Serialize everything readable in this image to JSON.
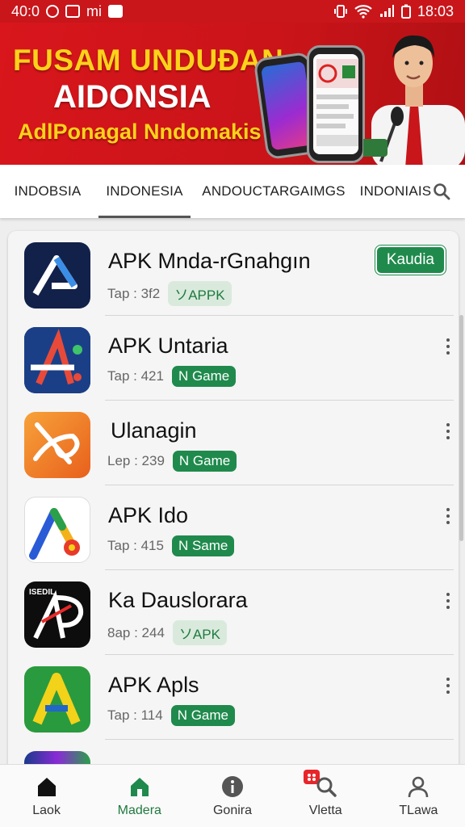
{
  "status": {
    "time_left": "40:0",
    "carrier": "mi",
    "time_right": "18:03"
  },
  "banner": {
    "title1": "FUSAM UNDUĐAN",
    "title2": "AIDONSIA",
    "subtitle": "AdlPonagal Nndomakis"
  },
  "tabs": [
    {
      "label": "INDOBSIA"
    },
    {
      "label": "INDONESIA"
    },
    {
      "label": "ANDOUCTARGAIMGS"
    },
    {
      "label": "INDONIAIS"
    }
  ],
  "apps": [
    {
      "name": "APK Mnda-rGnahgın",
      "meta": "Tap : 3f2",
      "badge": "ソAPPK",
      "badge_type": "apk",
      "action": "Kaudia"
    },
    {
      "name": "APK Untaria",
      "meta": "Tap : 421",
      "badge": "N Game",
      "badge_type": "game"
    },
    {
      "name": "Ulanagin",
      "meta": "Lep : 239",
      "badge": "N Game",
      "badge_type": "game"
    },
    {
      "name": "APK Ido",
      "meta": "Tap : 415",
      "badge": "N Same",
      "badge_type": "game"
    },
    {
      "name": "Ka Dauslorara",
      "meta": "8ap : 244",
      "badge": "ソAPK",
      "badge_type": "apk",
      "icon_text": "ISEDIL"
    },
    {
      "name": "APK Apls",
      "meta": "Tap : 114",
      "badge": "N Game",
      "badge_type": "game"
    }
  ],
  "nav": [
    {
      "label": "Laok",
      "icon": "home-icon"
    },
    {
      "label": "Madera",
      "icon": "store-icon"
    },
    {
      "label": "Gonira",
      "icon": "info-icon"
    },
    {
      "label": "Vletta",
      "icon": "search-icon"
    },
    {
      "label": "TLawa",
      "icon": "profile-icon"
    }
  ],
  "colors": {
    "brand_red": "#c8161b",
    "accent_green": "#1f8a4c",
    "banner_yellow": "#ffd21a"
  }
}
